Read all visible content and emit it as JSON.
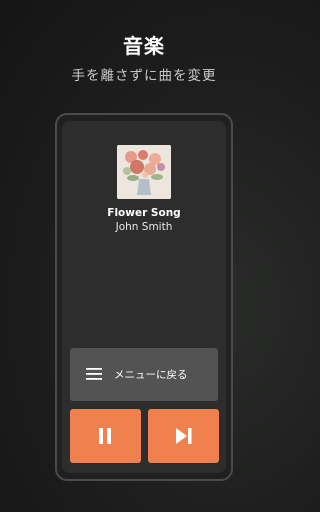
{
  "header": {
    "title": "音楽",
    "subtitle": "手を離さずに曲を変更"
  },
  "player": {
    "album_art_icon": "flower-bouquet-artwork",
    "song_title": "Flower Song",
    "artist": "John Smith"
  },
  "controls": {
    "menu_label": "メニューに戻る",
    "menu_icon": "hamburger-menu-icon",
    "pause_icon": "pause-icon",
    "next_icon": "skip-next-icon"
  },
  "colors": {
    "accent": "#f0804d",
    "menu_button": "#525352",
    "screen": "#2c2d2c",
    "background": "#1c1d1c"
  }
}
